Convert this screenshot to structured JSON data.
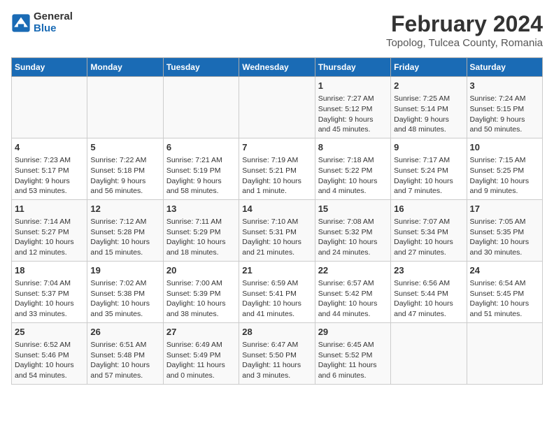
{
  "header": {
    "logo_general": "General",
    "logo_blue": "Blue",
    "title": "February 2024",
    "subtitle": "Topolog, Tulcea County, Romania"
  },
  "weekdays": [
    "Sunday",
    "Monday",
    "Tuesday",
    "Wednesday",
    "Thursday",
    "Friday",
    "Saturday"
  ],
  "weeks": [
    [
      {
        "day": "",
        "content": ""
      },
      {
        "day": "",
        "content": ""
      },
      {
        "day": "",
        "content": ""
      },
      {
        "day": "",
        "content": ""
      },
      {
        "day": "1",
        "content": "Sunrise: 7:27 AM\nSunset: 5:12 PM\nDaylight: 9 hours\nand 45 minutes."
      },
      {
        "day": "2",
        "content": "Sunrise: 7:25 AM\nSunset: 5:14 PM\nDaylight: 9 hours\nand 48 minutes."
      },
      {
        "day": "3",
        "content": "Sunrise: 7:24 AM\nSunset: 5:15 PM\nDaylight: 9 hours\nand 50 minutes."
      }
    ],
    [
      {
        "day": "4",
        "content": "Sunrise: 7:23 AM\nSunset: 5:17 PM\nDaylight: 9 hours\nand 53 minutes."
      },
      {
        "day": "5",
        "content": "Sunrise: 7:22 AM\nSunset: 5:18 PM\nDaylight: 9 hours\nand 56 minutes."
      },
      {
        "day": "6",
        "content": "Sunrise: 7:21 AM\nSunset: 5:19 PM\nDaylight: 9 hours\nand 58 minutes."
      },
      {
        "day": "7",
        "content": "Sunrise: 7:19 AM\nSunset: 5:21 PM\nDaylight: 10 hours\nand 1 minute."
      },
      {
        "day": "8",
        "content": "Sunrise: 7:18 AM\nSunset: 5:22 PM\nDaylight: 10 hours\nand 4 minutes."
      },
      {
        "day": "9",
        "content": "Sunrise: 7:17 AM\nSunset: 5:24 PM\nDaylight: 10 hours\nand 7 minutes."
      },
      {
        "day": "10",
        "content": "Sunrise: 7:15 AM\nSunset: 5:25 PM\nDaylight: 10 hours\nand 9 minutes."
      }
    ],
    [
      {
        "day": "11",
        "content": "Sunrise: 7:14 AM\nSunset: 5:27 PM\nDaylight: 10 hours\nand 12 minutes."
      },
      {
        "day": "12",
        "content": "Sunrise: 7:12 AM\nSunset: 5:28 PM\nDaylight: 10 hours\nand 15 minutes."
      },
      {
        "day": "13",
        "content": "Sunrise: 7:11 AM\nSunset: 5:29 PM\nDaylight: 10 hours\nand 18 minutes."
      },
      {
        "day": "14",
        "content": "Sunrise: 7:10 AM\nSunset: 5:31 PM\nDaylight: 10 hours\nand 21 minutes."
      },
      {
        "day": "15",
        "content": "Sunrise: 7:08 AM\nSunset: 5:32 PM\nDaylight: 10 hours\nand 24 minutes."
      },
      {
        "day": "16",
        "content": "Sunrise: 7:07 AM\nSunset: 5:34 PM\nDaylight: 10 hours\nand 27 minutes."
      },
      {
        "day": "17",
        "content": "Sunrise: 7:05 AM\nSunset: 5:35 PM\nDaylight: 10 hours\nand 30 minutes."
      }
    ],
    [
      {
        "day": "18",
        "content": "Sunrise: 7:04 AM\nSunset: 5:37 PM\nDaylight: 10 hours\nand 33 minutes."
      },
      {
        "day": "19",
        "content": "Sunrise: 7:02 AM\nSunset: 5:38 PM\nDaylight: 10 hours\nand 35 minutes."
      },
      {
        "day": "20",
        "content": "Sunrise: 7:00 AM\nSunset: 5:39 PM\nDaylight: 10 hours\nand 38 minutes."
      },
      {
        "day": "21",
        "content": "Sunrise: 6:59 AM\nSunset: 5:41 PM\nDaylight: 10 hours\nand 41 minutes."
      },
      {
        "day": "22",
        "content": "Sunrise: 6:57 AM\nSunset: 5:42 PM\nDaylight: 10 hours\nand 44 minutes."
      },
      {
        "day": "23",
        "content": "Sunrise: 6:56 AM\nSunset: 5:44 PM\nDaylight: 10 hours\nand 47 minutes."
      },
      {
        "day": "24",
        "content": "Sunrise: 6:54 AM\nSunset: 5:45 PM\nDaylight: 10 hours\nand 51 minutes."
      }
    ],
    [
      {
        "day": "25",
        "content": "Sunrise: 6:52 AM\nSunset: 5:46 PM\nDaylight: 10 hours\nand 54 minutes."
      },
      {
        "day": "26",
        "content": "Sunrise: 6:51 AM\nSunset: 5:48 PM\nDaylight: 10 hours\nand 57 minutes."
      },
      {
        "day": "27",
        "content": "Sunrise: 6:49 AM\nSunset: 5:49 PM\nDaylight: 11 hours\nand 0 minutes."
      },
      {
        "day": "28",
        "content": "Sunrise: 6:47 AM\nSunset: 5:50 PM\nDaylight: 11 hours\nand 3 minutes."
      },
      {
        "day": "29",
        "content": "Sunrise: 6:45 AM\nSunset: 5:52 PM\nDaylight: 11 hours\nand 6 minutes."
      },
      {
        "day": "",
        "content": ""
      },
      {
        "day": "",
        "content": ""
      }
    ]
  ]
}
